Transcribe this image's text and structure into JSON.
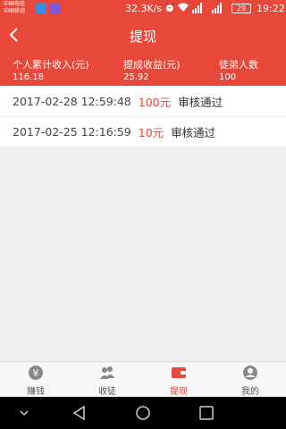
{
  "status_bar": {
    "carrier_1": "中国电信",
    "carrier_2": "中国移动",
    "speed": "32.3K/s",
    "battery": "29",
    "time": "19:22",
    "signal_labels": "4G 2G"
  },
  "header": {
    "title": "提现",
    "back_icon": "chevron-left-icon"
  },
  "stats": {
    "income_label": "个人累计收入(元)",
    "income_value": "116.18",
    "commission_label": "提成收益(元)",
    "commission_value": "25.92",
    "disciples_label": "徒弟人数",
    "disciples_value": "100"
  },
  "withdrawals": [
    {
      "time": "2017-02-28 12:59:48",
      "amount": "100元",
      "status": "审核通过"
    },
    {
      "time": "2017-02-25 12:16:59",
      "amount": "10元",
      "status": "审核通过"
    }
  ],
  "tabbar": {
    "items": [
      {
        "label": "赚钱",
        "icon": "yen-coin-icon"
      },
      {
        "label": "收徒",
        "icon": "users-icon"
      },
      {
        "label": "提现",
        "icon": "wallet-icon"
      },
      {
        "label": "我的",
        "icon": "user-icon"
      }
    ],
    "active_index": 2
  },
  "colors": {
    "brand": "#e8483a",
    "text": "#333333",
    "background": "#efefef"
  }
}
